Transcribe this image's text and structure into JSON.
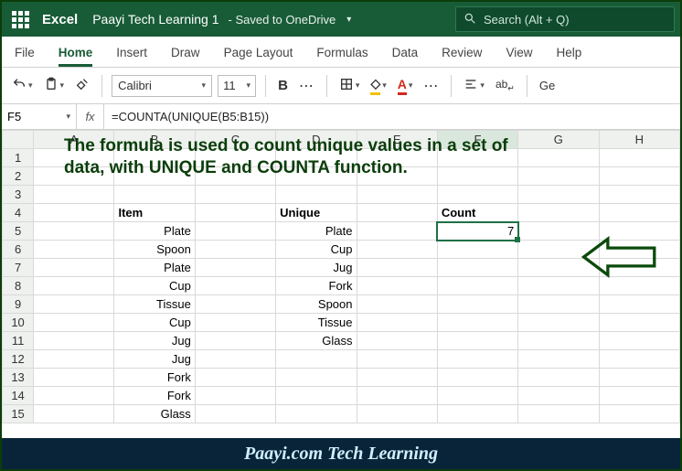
{
  "title": {
    "app": "Excel",
    "doc": "Paayi Tech Learning 1",
    "status": "- Saved to OneDrive"
  },
  "search": {
    "placeholder": "Search (Alt + Q)"
  },
  "tabs": {
    "file": "File",
    "home": "Home",
    "insert": "Insert",
    "draw": "Draw",
    "page": "Page Layout",
    "formulas": "Formulas",
    "data": "Data",
    "review": "Review",
    "view": "View",
    "help": "Help"
  },
  "toolbar": {
    "font": "Calibri",
    "size": "11",
    "bold": "B",
    "fillGlyph": "🪣",
    "fontA": "A",
    "alignR": "Ge",
    "wrap": "ab"
  },
  "fbar": {
    "cell": "F5",
    "fx": "fx",
    "formula": "=COUNTA(UNIQUE(B5:B15))"
  },
  "cols": {
    "A": "A",
    "B": "B",
    "C": "C",
    "D": "D",
    "E": "E",
    "F": "F",
    "G": "G",
    "H": "H"
  },
  "banner": {
    "l1": "The formula is used to count unique values in a set of",
    "l2": "data, with UNIQUE and COUNTA function."
  },
  "headers": {
    "item": "Item",
    "unique": "Unique",
    "count": "Count"
  },
  "items": {
    "r5": "Plate",
    "r6": "Spoon",
    "r7": "Plate",
    "r8": "Cup",
    "r9": "Tissue",
    "r10": "Cup",
    "r11": "Jug",
    "r12": "Jug",
    "r13": "Fork",
    "r14": "Fork",
    "r15": "Glass"
  },
  "unique": {
    "r5": "Plate",
    "r6": "Cup",
    "r7": "Jug",
    "r8": "Fork",
    "r9": "Spoon",
    "r10": "Tissue",
    "r11": "Glass"
  },
  "count": "7",
  "rows": {
    "r1": "1",
    "r2": "2",
    "r3": "3",
    "r4": "4",
    "r5": "5",
    "r6": "6",
    "r7": "7",
    "r8": "8",
    "r9": "9",
    "r10": "10",
    "r11": "11",
    "r12": "12",
    "r13": "13",
    "r14": "14",
    "r15": "15"
  },
  "footer": "Paayi.com Tech Learning"
}
